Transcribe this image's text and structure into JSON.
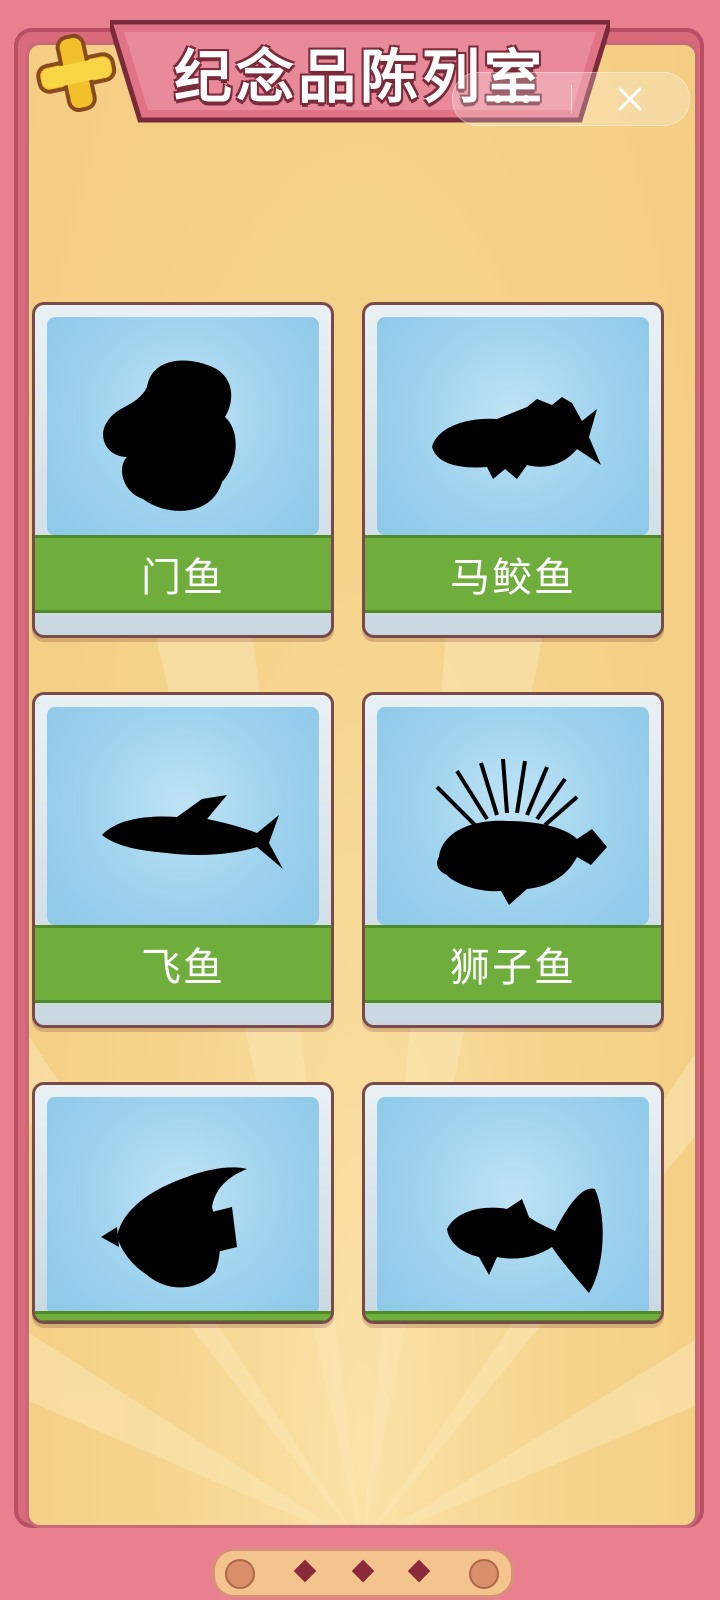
{
  "header": {
    "title": "纪念品陈列室",
    "close_icon": "x-close-icon",
    "capsule": {
      "more_icon": "more-dots-icon",
      "exit_icon": "close-icon"
    }
  },
  "cards": [
    {
      "name": "门鱼",
      "icon": "door-fish-silhouette"
    },
    {
      "name": "马鲛鱼",
      "icon": "mackerel-silhouette"
    },
    {
      "name": "飞鱼",
      "icon": "flying-fish-silhouette"
    },
    {
      "name": "狮子鱼",
      "icon": "lionfish-silhouette"
    },
    {
      "name": "",
      "icon": "angelfish-silhouette"
    },
    {
      "name": "",
      "icon": "guppy-silhouette"
    }
  ],
  "pager": {
    "pages": 3,
    "active": 1
  },
  "colors": {
    "frame": "#e8808f",
    "panel": "#f6d48c",
    "label_green": "#6fae3c",
    "sky_blue": "#9dd2ee",
    "silhouette": "#000000"
  }
}
